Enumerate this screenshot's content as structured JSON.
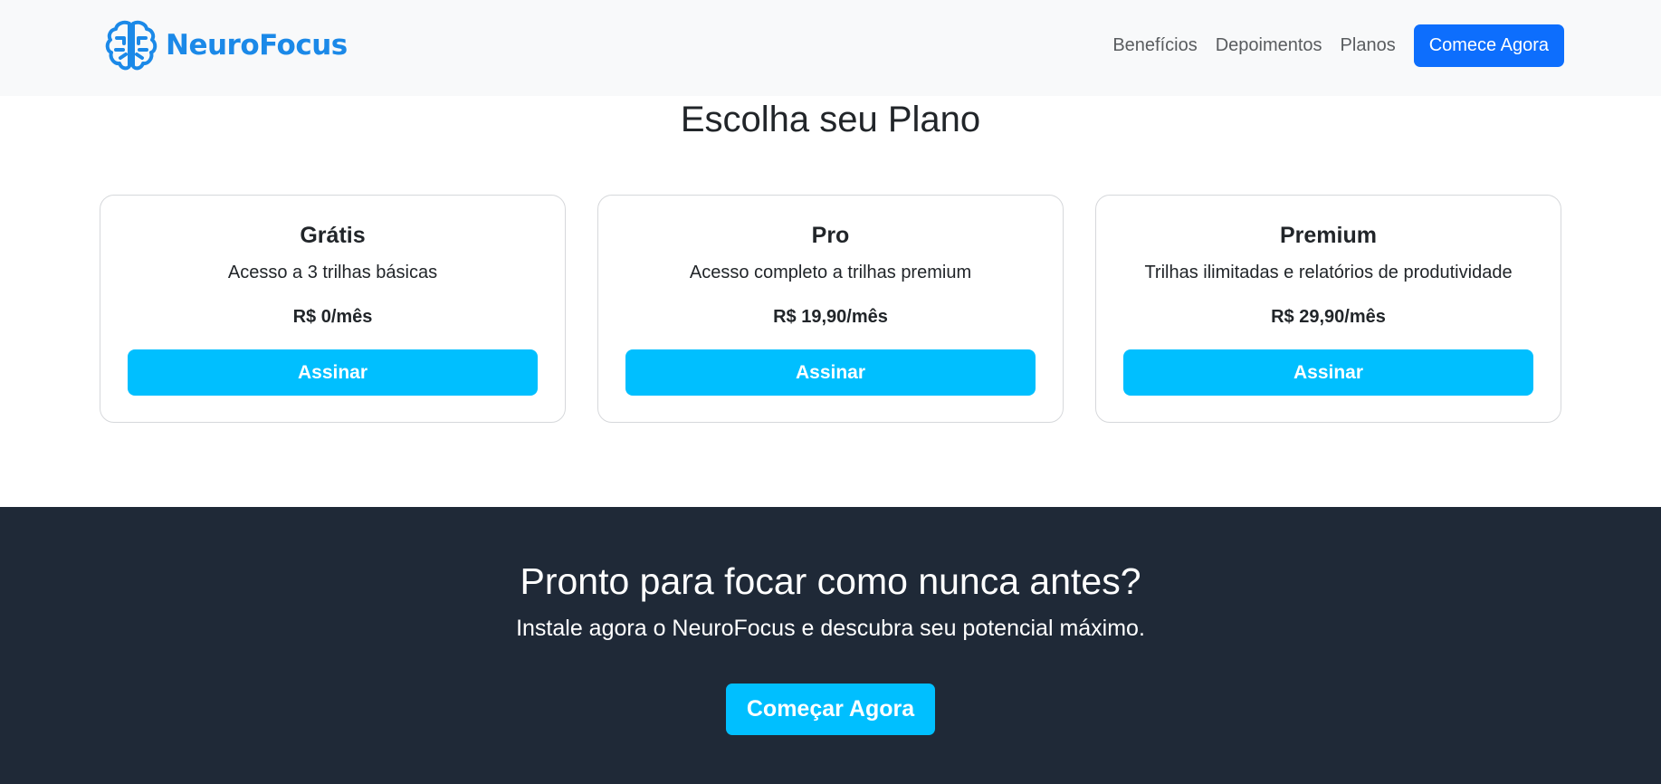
{
  "brand": {
    "name": "NeuroFocus",
    "icon": "brain-icon",
    "color": "#1b89e8"
  },
  "nav": {
    "links": [
      "Benefícios",
      "Depoimentos",
      "Planos"
    ],
    "cta_label": "Comece Agora"
  },
  "plans": {
    "title": "Escolha seu Plano",
    "items": [
      {
        "name": "Grátis",
        "description": "Acesso a 3 trilhas básicas",
        "price": "R$ 0/mês",
        "button": "Assinar"
      },
      {
        "name": "Pro",
        "description": "Acesso completo a trilhas premium",
        "price": "R$ 19,90/mês",
        "button": "Assinar"
      },
      {
        "name": "Premium",
        "description": "Trilhas ilimitadas e relatórios de produtividade",
        "price": "R$ 29,90/mês",
        "button": "Assinar"
      }
    ]
  },
  "cta": {
    "title": "Pronto para focar como nunca antes?",
    "subtitle": "Instale agora o NeuroFocus e descubra seu potencial máximo.",
    "button": "Começar Agora"
  },
  "colors": {
    "primary": "#0d6efd",
    "accent": "#00bfff",
    "dark": "#1f2937",
    "navbar_bg": "#f8f9fa"
  }
}
